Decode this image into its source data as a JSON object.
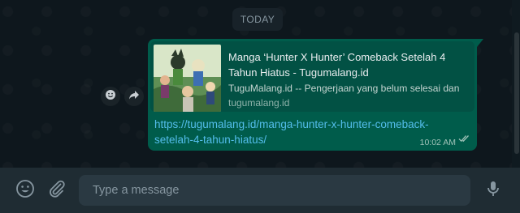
{
  "chat": {
    "date_divider": "TODAY"
  },
  "message": {
    "preview": {
      "title": "Manga ‘Hunter X Hunter’ Comeback Setelah 4 Tahun Hiatus - Tugumalang.id",
      "description": "TuguMalang.id -- Pengerjaan yang belum selesai dan",
      "domain": "tugumalang.id"
    },
    "link_text": "https://tugumalang.id/manga-hunter-x-hunter-comeback-setelah-4-tahun-hiatus/",
    "time": "10:02 AM",
    "status": "read"
  },
  "actions": {
    "react_icon": "smiley-icon",
    "forward_icon": "forward-arrow-icon"
  },
  "composer": {
    "placeholder": "Type a message",
    "emoji_icon": "emoji-icon",
    "attach_icon": "paperclip-icon",
    "mic_icon": "microphone-icon"
  },
  "colors": {
    "bubble": "#005c4b",
    "link": "#53bdeb",
    "background": "#0b141a"
  }
}
